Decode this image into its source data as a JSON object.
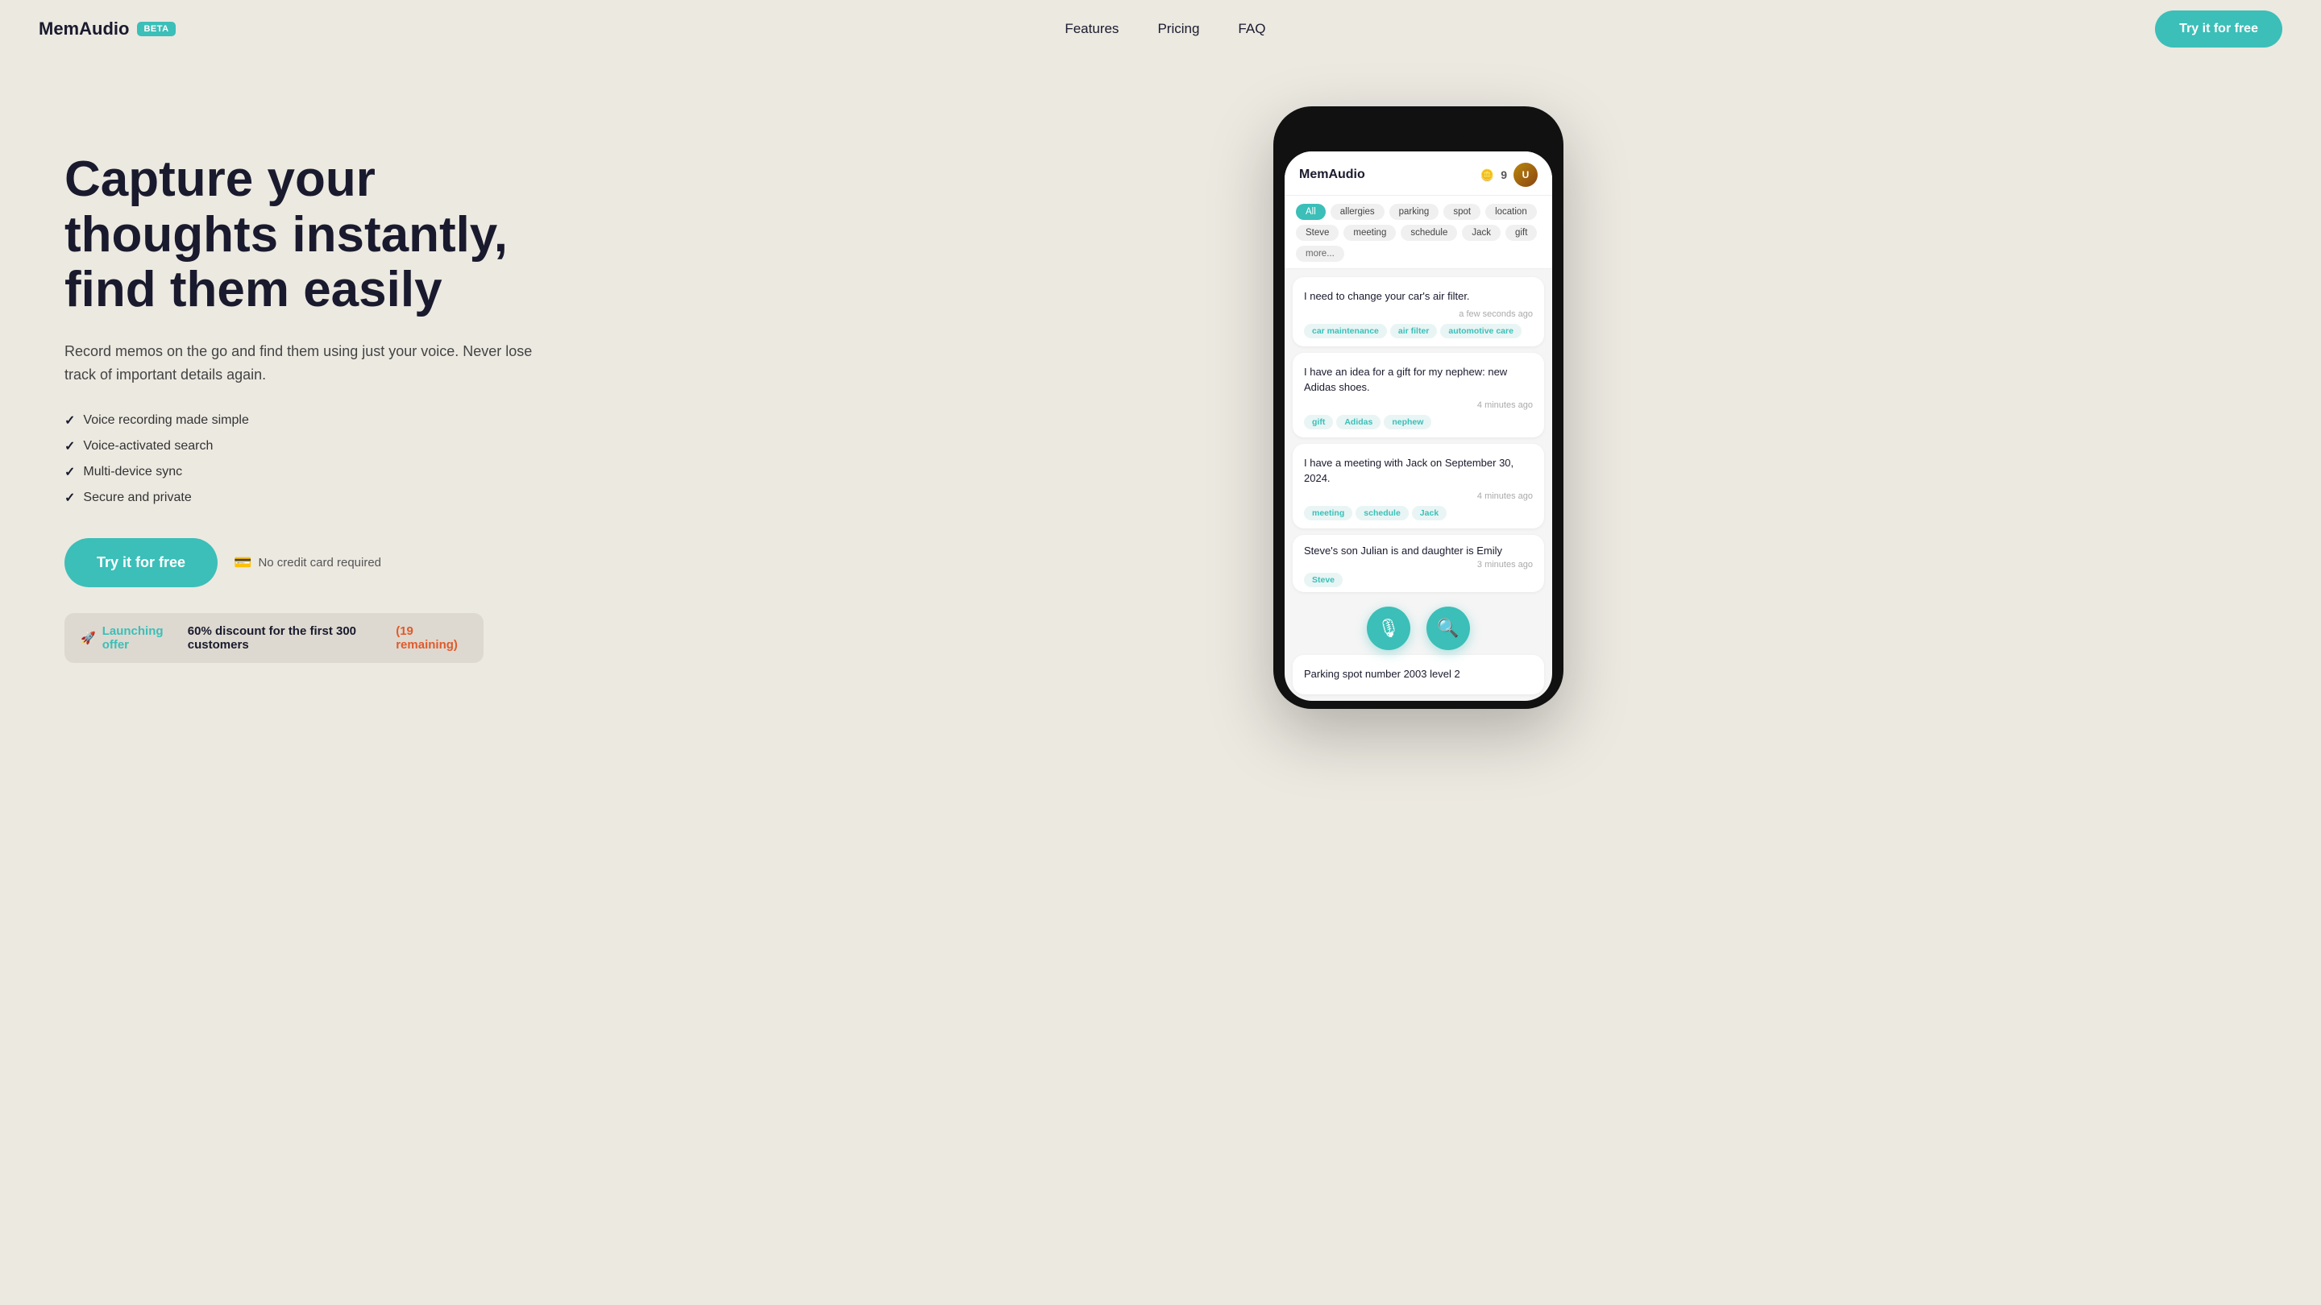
{
  "nav": {
    "logo": "MemAudio",
    "beta_badge": "BETA",
    "links": [
      {
        "label": "Features",
        "href": "#"
      },
      {
        "label": "Pricing",
        "href": "#"
      },
      {
        "label": "FAQ",
        "href": "#"
      }
    ],
    "cta": "Try it for free"
  },
  "hero": {
    "heading": "Capture your thoughts instantly, find them easily",
    "subtext": "Record memos on the go and find them using just your voice. Never lose track of important details again.",
    "features": [
      "Voice recording made simple",
      "Voice-activated search",
      "Multi-device sync",
      "Secure and private"
    ],
    "cta_button": "Try it for free",
    "no_cc": "No credit card required",
    "launch_label": "Launching offer",
    "launch_discount": "60% discount for the first 300 customers",
    "launch_remaining": "(19 remaining)"
  },
  "app": {
    "title": "MemAudio",
    "coin_count": "9",
    "tags": [
      {
        "label": "All",
        "active": true
      },
      {
        "label": "allergies"
      },
      {
        "label": "parking"
      },
      {
        "label": "spot"
      },
      {
        "label": "location"
      },
      {
        "label": "Steve"
      },
      {
        "label": "meeting"
      },
      {
        "label": "schedule"
      },
      {
        "label": "Jack"
      },
      {
        "label": "gift"
      },
      {
        "label": "more...",
        "more": true
      }
    ],
    "memos": [
      {
        "text": "I need to change your car's air filter.",
        "time": "a few seconds ago",
        "tags": [
          "car maintenance",
          "air filter",
          "automotive care"
        ]
      },
      {
        "text": "I have an idea for a gift for my nephew: new Adidas shoes.",
        "time": "4 minutes ago",
        "tags": [
          "gift",
          "Adidas",
          "nephew"
        ]
      },
      {
        "text": "I have a meeting with Jack on September 30, 2024.",
        "time": "4 minutes ago",
        "tags": [
          "meeting",
          "schedule",
          "Jack"
        ]
      },
      {
        "text": "Steve's son Julian is and daughter is Emily",
        "time": "3 minutes ago",
        "tags": [
          "Steve"
        ]
      },
      {
        "text": "Parking spot number 2003 level 2",
        "time": "",
        "tags": []
      }
    ]
  }
}
